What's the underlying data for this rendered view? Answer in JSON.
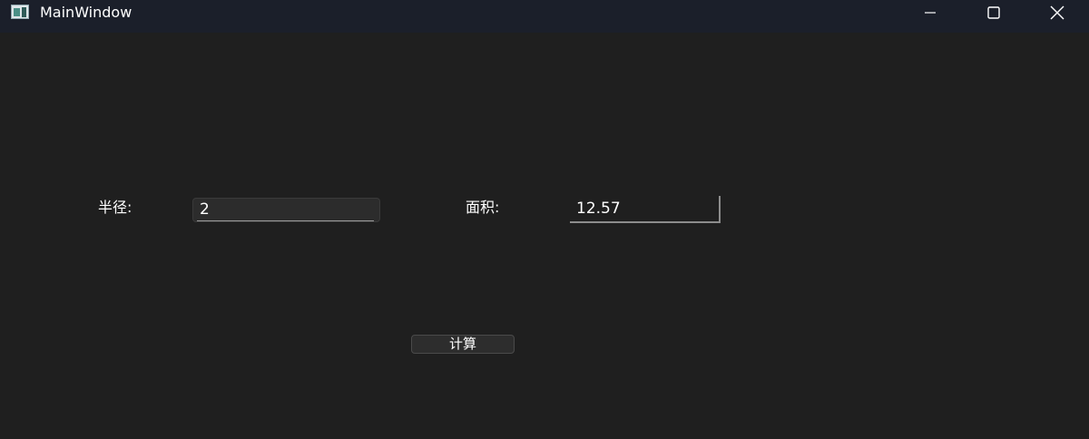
{
  "window": {
    "title": "MainWindow"
  },
  "form": {
    "radius_label": "半径:",
    "radius_value": "2",
    "area_label": "面积:",
    "area_value": "12.57"
  },
  "actions": {
    "calculate_label": "计算"
  },
  "icons": {
    "app": "app-icon",
    "minimize": "minimize-icon",
    "maximize": "maximize-icon",
    "close": "close-icon"
  },
  "colors": {
    "background": "#1f1f1f",
    "titlebar": "#1b1f2a",
    "text": "#ffffff"
  }
}
